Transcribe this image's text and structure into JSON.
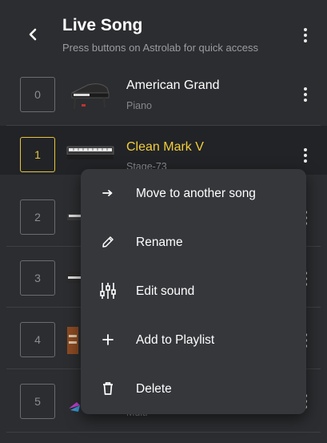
{
  "header": {
    "back_icon": "chevron-left-icon",
    "title": "Live Song",
    "subtitle": "Press buttons on Astrolab for quick access",
    "menu_icon": "more-vertical-icon"
  },
  "sounds": [
    {
      "slot": "0",
      "name": "American Grand",
      "category": "Piano",
      "selected": false
    },
    {
      "slot": "1",
      "name": "Clean Mark V",
      "category": "Stage-73",
      "selected": true
    },
    {
      "slot": "2",
      "name": "",
      "category": "",
      "selected": false
    },
    {
      "slot": "3",
      "name": "",
      "category": "",
      "selected": false
    },
    {
      "slot": "4",
      "name": "",
      "category": "",
      "selected": false
    },
    {
      "slot": "5",
      "name": "",
      "category": "Multi",
      "selected": false
    }
  ],
  "context_menu": {
    "items": [
      {
        "label": "Move to another song",
        "icon": "arrow-right-icon"
      },
      {
        "label": "Rename",
        "icon": "pencil-icon"
      },
      {
        "label": "Edit sound",
        "icon": "sliders-icon"
      },
      {
        "label": "Add to Playlist",
        "icon": "plus-icon"
      },
      {
        "label": "Delete",
        "icon": "trash-icon"
      }
    ]
  },
  "colors": {
    "background": "#2c2d30",
    "selected_row": "#222326",
    "accent_yellow": "#f2ce3b",
    "menu_background": "#36373b"
  }
}
